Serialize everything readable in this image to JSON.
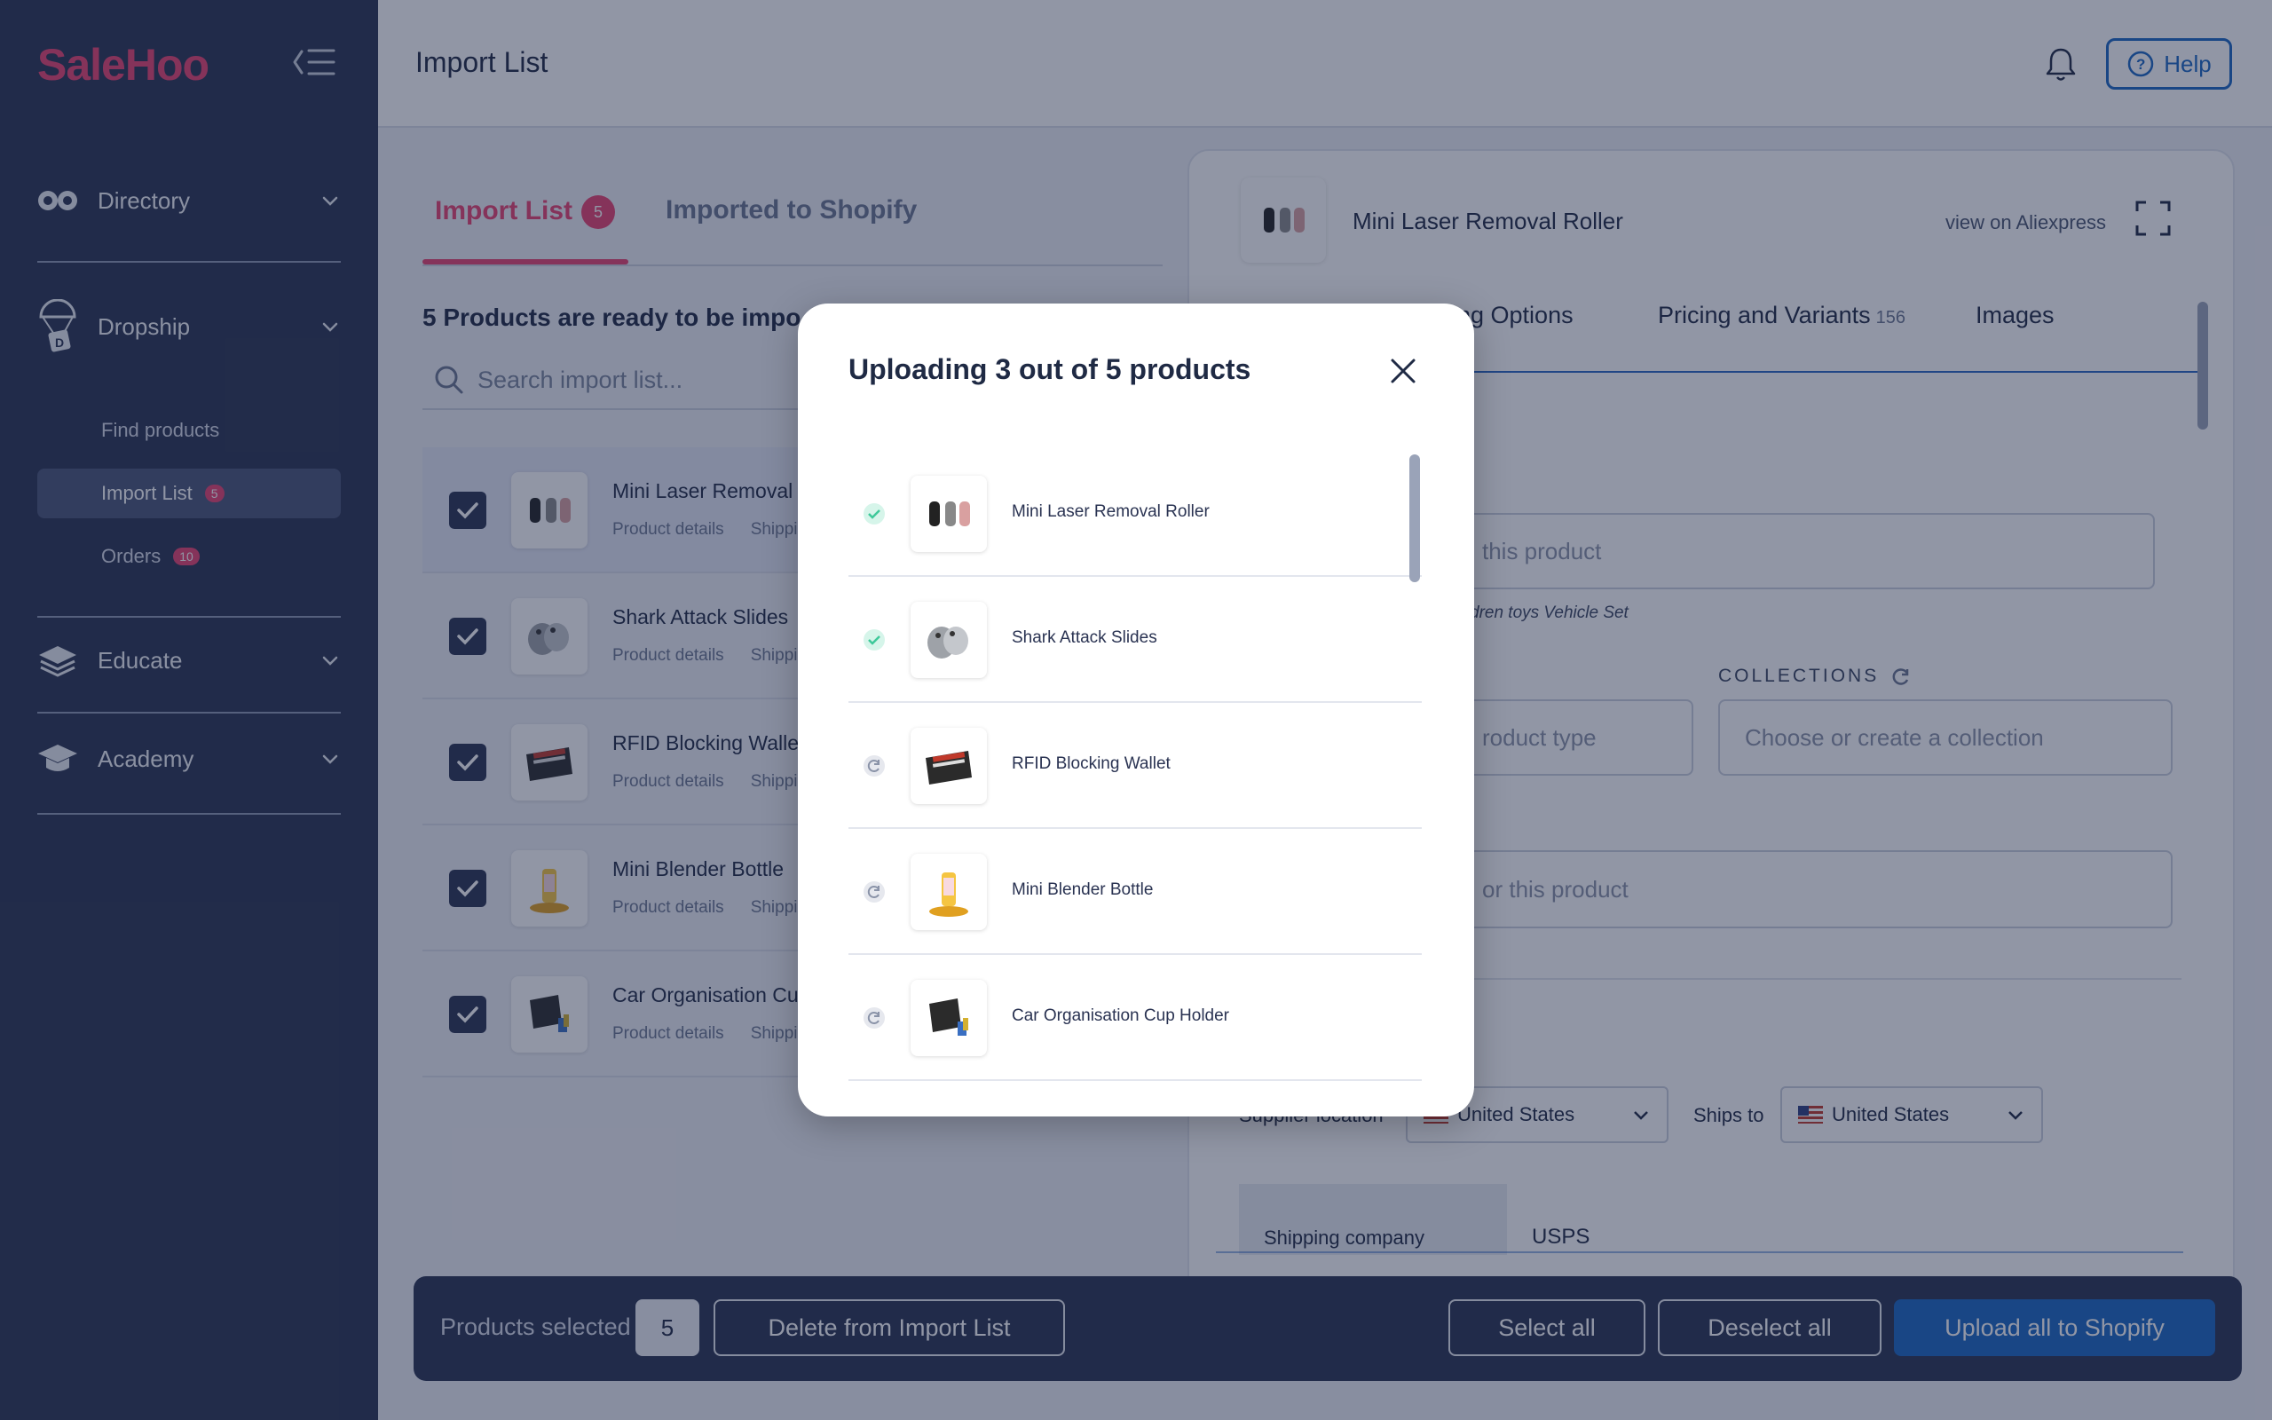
{
  "app": {
    "logo": "SaleHoo"
  },
  "sidebar": {
    "sections": [
      {
        "label": "Directory"
      },
      {
        "label": "Dropship"
      },
      {
        "label": "Educate"
      },
      {
        "label": "Academy"
      }
    ],
    "subnav": [
      {
        "label": "Find products",
        "badge": ""
      },
      {
        "label": "Import List",
        "badge": "5"
      },
      {
        "label": "Orders",
        "badge": "10"
      }
    ]
  },
  "header": {
    "title": "Import List",
    "help_label": "Help"
  },
  "list": {
    "tabs": [
      {
        "label": "Import List",
        "badge": "5"
      },
      {
        "label": "Imported to Shopify"
      }
    ],
    "ready_text": "5 Products are ready to be impo",
    "search_placeholder": "Search import list...",
    "link_details": "Product details",
    "link_shipping": "Shippi",
    "products": [
      {
        "name": "Mini Laser Removal R"
      },
      {
        "name": "Shark Attack Slides"
      },
      {
        "name": "RFID Blocking Wallet"
      },
      {
        "name": "Mini Blender Bottle"
      },
      {
        "name": "Car Organisation Cup"
      }
    ]
  },
  "detail": {
    "title": "Mini Laser Removal Roller",
    "aliexpress_link": "view on Aliexpress",
    "tabs": [
      {
        "label": "ing Options",
        "count": ""
      },
      {
        "label": "Pricing and Variants",
        "count": "156"
      },
      {
        "label": "Images",
        "count": ""
      }
    ],
    "title_placeholder": "this product",
    "tags_hint": "dren toys Vehicle Set",
    "collections_label": "COLLECTIONS",
    "type_placeholder": "roduct type",
    "collection_placeholder": "Choose or create a collection",
    "vendor_placeholder": "or this product",
    "supplier_location_label": "Supplier location",
    "supplier_location_value": "United States",
    "ships_to_label": "Ships to",
    "ships_to_value": "United States",
    "shipping_company_label": "Shipping company",
    "shipping_company_value": "USPS"
  },
  "bottom_bar": {
    "selected_label": "Products selected",
    "selected_count": "5",
    "delete_label": "Delete from Import List",
    "select_all_label": "Select all",
    "deselect_all_label": "Deselect all",
    "upload_label": "Upload all to Shopify"
  },
  "modal": {
    "title": "Uploading 3 out of 5 products",
    "items": [
      {
        "name": "Mini Laser Removal Roller",
        "status": "done"
      },
      {
        "name": "Shark Attack Slides",
        "status": "done"
      },
      {
        "name": "RFID Blocking Wallet",
        "status": "pending"
      },
      {
        "name": "Mini Blender Bottle",
        "status": "pending"
      },
      {
        "name": "Car Organisation Cup Holder",
        "status": "pending"
      }
    ]
  },
  "colors": {
    "brand": "#e8416f",
    "sidebar": "#2a3352",
    "primary": "#1a66c2",
    "success": "#3ec99a"
  }
}
